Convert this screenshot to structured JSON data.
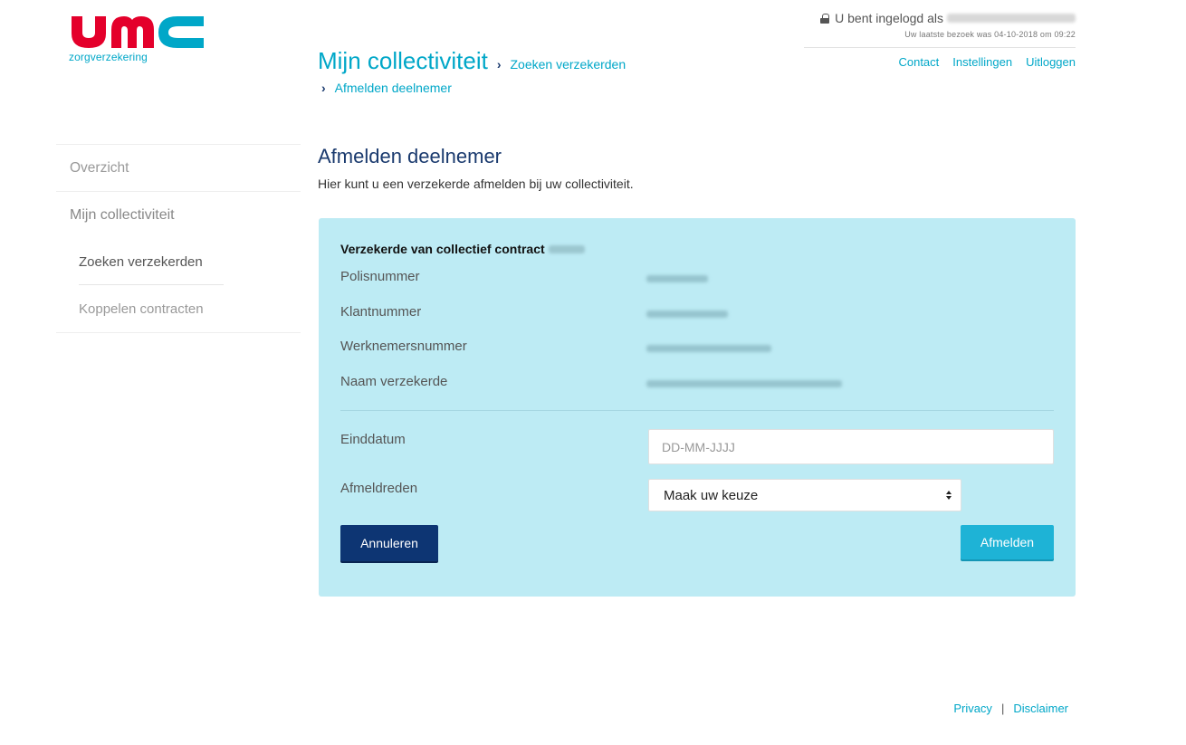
{
  "brand": {
    "logo_text": "umc",
    "logo_sub": "zorgverzekering",
    "colors": {
      "red": "#e4002b",
      "cyan": "#00a7c8",
      "navy": "#1a3a6e"
    }
  },
  "header": {
    "login_text": "U bent ingelogd als",
    "last_visit": "Uw laatste bezoek was 04-10-2018 om 09:22",
    "links": {
      "contact": "Contact",
      "settings": "Instellingen",
      "logout": "Uitloggen"
    }
  },
  "breadcrumb": {
    "title": "Mijn collectiviteit",
    "sep": "›",
    "level2": "Zoeken verzekerden",
    "level3": "Afmelden deelnemer"
  },
  "sidebar": {
    "overview": "Overzicht",
    "collectivity": "Mijn collectiviteit",
    "search_insured": "Zoeken verzekerden",
    "link_contracts": "Koppelen contracten"
  },
  "page": {
    "title": "Afmelden deelnemer",
    "intro": "Hier kunt u een verzekerde afmelden bij uw collectiviteit."
  },
  "card": {
    "heading": "Verzekerde van collectief contract",
    "rows": {
      "policy": "Polisnummer",
      "client": "Klantnummer",
      "employee": "Werknemersnummer",
      "name": "Naam verzekerde"
    }
  },
  "form": {
    "end_date_label": "Einddatum",
    "end_date_placeholder": "DD-MM-JJJJ",
    "reason_label": "Afmeldreden",
    "reason_selected": "Maak uw keuze",
    "cancel_label": "Annuleren",
    "submit_label": "Afmelden"
  },
  "footer": {
    "privacy": "Privacy",
    "sep": "|",
    "disclaimer": "Disclaimer"
  }
}
